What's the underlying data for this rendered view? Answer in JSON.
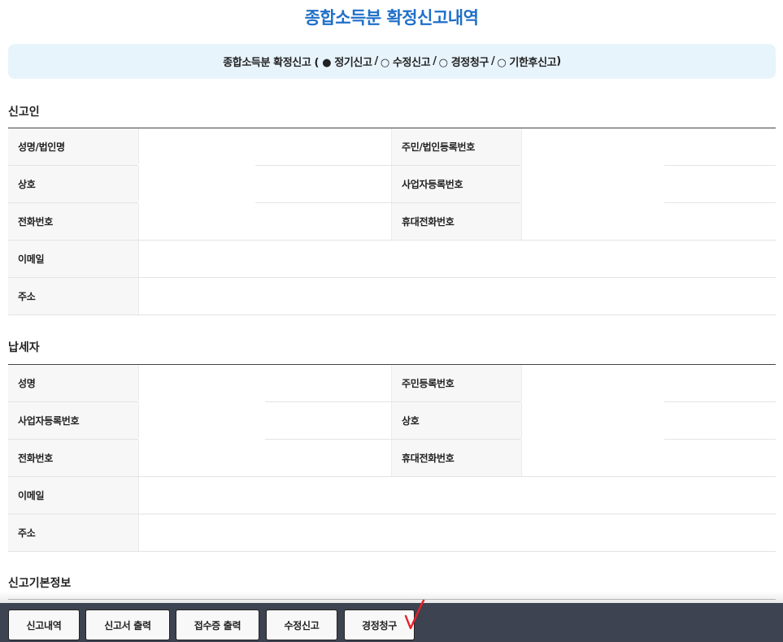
{
  "page": {
    "title": "종합소득분 확정신고내역"
  },
  "report_type": {
    "prefix": "종합소득분 확정신고 (",
    "suffix": ")",
    "separator": "/",
    "options": [
      {
        "marker": "●",
        "label": "정기신고",
        "selected": true
      },
      {
        "marker": "○",
        "label": "수정신고",
        "selected": false
      },
      {
        "marker": "○",
        "label": "경정청구",
        "selected": false
      },
      {
        "marker": "○",
        "label": "기한후신고",
        "selected": false
      }
    ]
  },
  "reporter": {
    "title": "신고인",
    "labels": {
      "name": "성명/법인명",
      "reg_no": "주민/법인등록번호",
      "trade_name": "상호",
      "biz_no": "사업자등록번호",
      "phone": "전화번호",
      "mobile": "휴대전화번호",
      "email": "이메일",
      "address": "주소"
    }
  },
  "taxpayer": {
    "title": "납세자",
    "labels": {
      "name": "성명",
      "reg_no": "주민등록번호",
      "biz_no": "사업자등록번호",
      "trade_name": "상호",
      "phone": "전화번호",
      "mobile": "휴대전화번호",
      "email": "이메일",
      "address": "주소"
    }
  },
  "basic_info": {
    "title": "신고기본정보"
  },
  "buttons": {
    "history": "신고내역",
    "print_report": "신고서 출력",
    "print_receipt": "접수증 출력",
    "amend": "수정신고",
    "correction": "경정청구"
  },
  "colors": {
    "title": "#1f6fc9",
    "info_box": "#e8f4fc",
    "bottom_bar": "#3d4350",
    "annotation": "#e8202a"
  }
}
